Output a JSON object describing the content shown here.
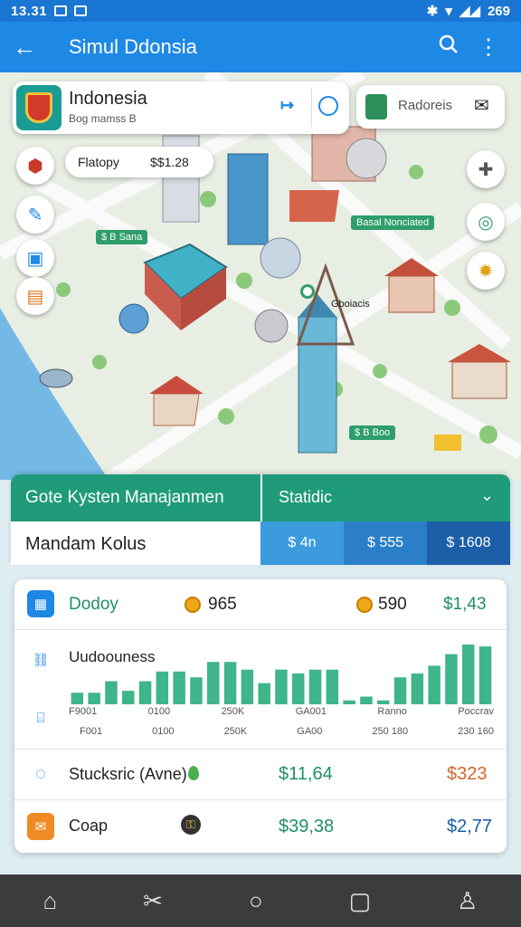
{
  "status": {
    "time": "13.31",
    "battery": "269"
  },
  "appbar": {
    "title": "Simul Ddonsia"
  },
  "location_card": {
    "title": "Indonesia",
    "subtitle": "Bog mamss B"
  },
  "region_card": {
    "label": "Radoreis"
  },
  "price_pill": {
    "label": "Flatopy",
    "value": "$$1.28"
  },
  "map_labels": [
    "$ B Sana",
    "Basal Nonciated",
    "$ B Boo",
    "Gboiacis"
  ],
  "panel": {
    "header_left": "Gote Kysten Manajanmen",
    "header_right": "Statidic",
    "subtitle": "Mandam Kolus",
    "tabs": [
      "$ 4n",
      "$ 555",
      "$ 1608"
    ]
  },
  "list": {
    "today": {
      "label": "Dodoy",
      "a": "965",
      "b": "590",
      "c": "$1,43"
    },
    "chart": {
      "label": "Uudoouness",
      "ticks": [
        "F9001",
        "0100",
        "250K",
        "GA001",
        "Ranno",
        "Poccrav"
      ],
      "ticks2": [
        "F001",
        "0100",
        "250K",
        "GA00",
        "250 180",
        "230 160"
      ]
    },
    "stocks": {
      "label": "Stucksric (Avne)",
      "value": "$11,64",
      "value2": "$323"
    },
    "cash": {
      "label": "Coap",
      "value": "$39,38",
      "value2": "$2,77"
    }
  },
  "chart_data": {
    "type": "bar",
    "values": [
      12,
      12,
      24,
      14,
      24,
      34,
      34,
      28,
      44,
      44,
      36,
      22,
      36,
      32,
      36,
      36,
      4,
      8,
      4,
      28,
      32,
      40,
      52,
      62,
      60
    ]
  }
}
